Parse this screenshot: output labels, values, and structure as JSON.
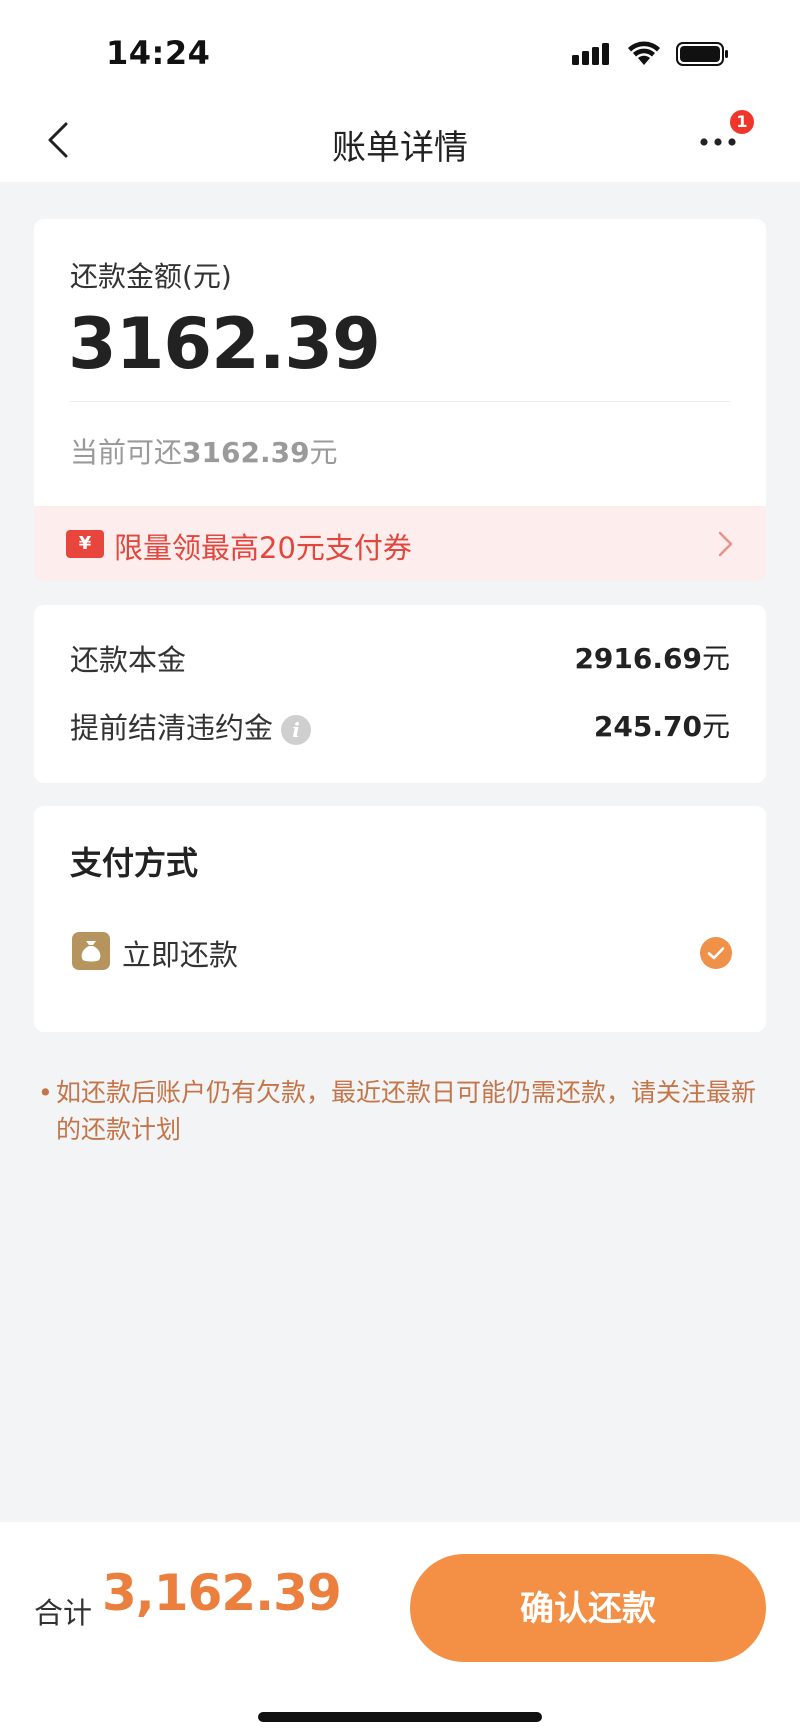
{
  "status_bar": {
    "time": "14:24"
  },
  "nav": {
    "title": "账单详情",
    "badge": "1"
  },
  "amount_card": {
    "label": "还款金额(元)",
    "amount": "3162.39",
    "available_prefix": "当前可还",
    "available_amount": "3162.39",
    "available_suffix": "元"
  },
  "coupon": {
    "icon_text": "¥",
    "text": "限量领最高20元支付券"
  },
  "breakdown": {
    "rows": [
      {
        "label": "还款本金",
        "value": "2916.69",
        "unit": "元"
      },
      {
        "label": "提前结清违约金",
        "value": "245.70",
        "unit": "元"
      }
    ]
  },
  "payment": {
    "title": "支付方式",
    "method": "立即还款",
    "selected": true
  },
  "notice": {
    "bullet": "•",
    "text": "如还款后账户仍有欠款，最近还款日可能仍需还款，请关注最新的还款计划"
  },
  "footer": {
    "total_label": "合计",
    "total_value": "3,162.39",
    "confirm_label": "确认还款"
  },
  "colors": {
    "accent": "#f49045",
    "coupon_red": "#e2463d",
    "badge_red": "#f0352b",
    "notice": "#c4764a"
  }
}
